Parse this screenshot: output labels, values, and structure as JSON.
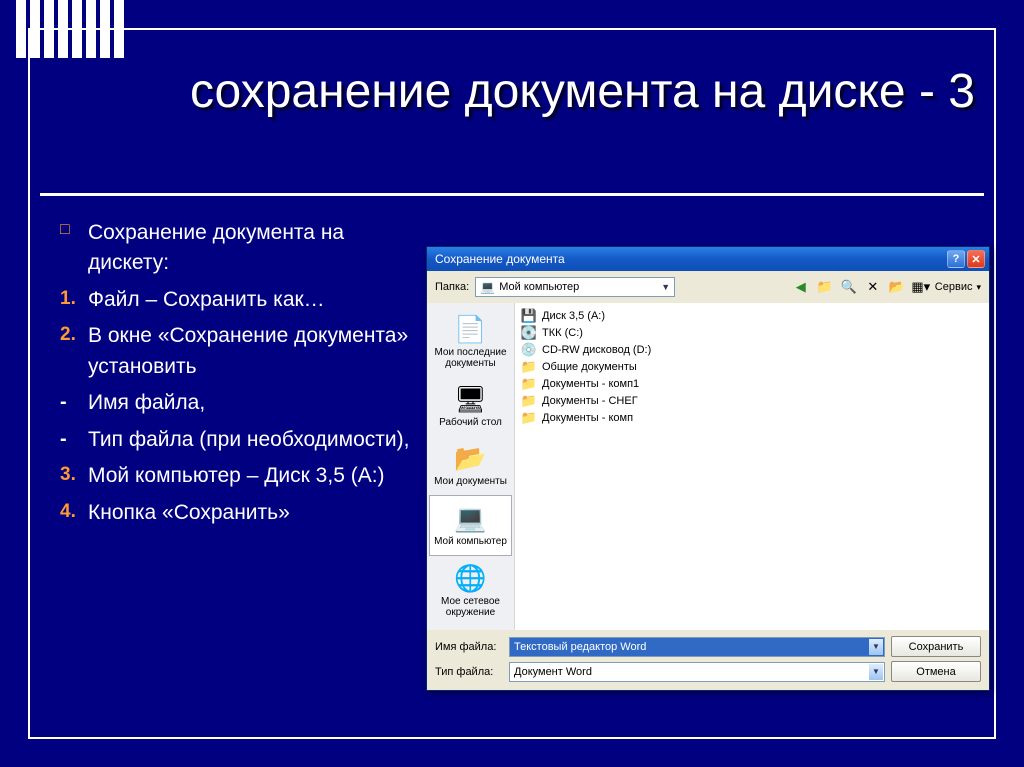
{
  "slide": {
    "title": "сохранение документа на диске - 3",
    "bullets": [
      {
        "marker": "□",
        "markerClass": "mk-box",
        "text": "Сохранение документа на дискету:"
      },
      {
        "marker": "1.",
        "markerClass": "mk-num",
        "text": "Файл – Сохранить как…"
      },
      {
        "marker": "2.",
        "markerClass": "mk-num",
        "text": "В окне «Сохранение документа» установить"
      },
      {
        "marker": "-",
        "markerClass": "mk-dash",
        "text": "Имя файла,"
      },
      {
        "marker": "-",
        "markerClass": "mk-dash",
        "text": "Тип файла (при необходимости),"
      },
      {
        "marker": "3.",
        "markerClass": "mk-num",
        "text": "Мой компьютер – Диск 3,5 (А:)"
      },
      {
        "marker": "4.",
        "markerClass": "mk-num",
        "text": "Кнопка «Сохранить»"
      }
    ]
  },
  "dialog": {
    "title": "Сохранение документа",
    "folder_label": "Папка:",
    "folder_value": "Мой компьютер",
    "service_label": "Сервис",
    "sidebar": [
      {
        "icon": "📄",
        "label": "Мои последние документы",
        "selected": false
      },
      {
        "icon": "🖥",
        "label": "Рабочий стол",
        "selected": false
      },
      {
        "icon": "📂",
        "label": "Мои документы",
        "selected": false
      },
      {
        "icon": "💻",
        "label": "Мой компьютер",
        "selected": true
      },
      {
        "icon": "🌐",
        "label": "Мое сетевое окружение",
        "selected": false
      }
    ],
    "files": [
      {
        "icon": "💾",
        "name": "Диск 3,5 (A:)"
      },
      {
        "icon": "💽",
        "name": "ТКК (C:)"
      },
      {
        "icon": "💿",
        "name": "CD-RW дисковод (D:)"
      },
      {
        "icon": "📁",
        "name": "Общие документы"
      },
      {
        "icon": "📁",
        "name": "Документы - комп1"
      },
      {
        "icon": "📁",
        "name": "Документы - СНЕГ"
      },
      {
        "icon": "📁",
        "name": "Документы - комп"
      }
    ],
    "filename_label": "Имя файла:",
    "filename_value": "Текстовый редактор Word",
    "filetype_label": "Тип файла:",
    "filetype_value": "Документ Word",
    "save_button": "Сохранить",
    "cancel_button": "Отмена"
  }
}
